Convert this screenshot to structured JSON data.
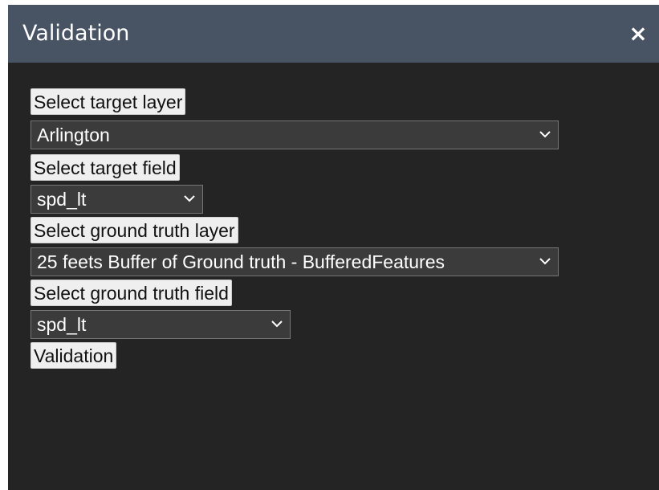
{
  "dialog": {
    "title": "Validation",
    "close_symbol": "×",
    "close_icon": "close-icon"
  },
  "form": {
    "target_layer_button": "Select target layer",
    "target_layer_value": "Arlington",
    "target_field_button": "Select target field",
    "target_field_value": "spd_lt",
    "ground_truth_layer_button": "Select ground truth layer",
    "ground_truth_layer_value": "25 feets Buffer of Ground truth - BufferedFeatures",
    "ground_truth_field_button": "Select ground truth field",
    "ground_truth_field_value": "spd_lt",
    "validation_button": "Validation",
    "chevron_icon": "chevron-down-icon"
  },
  "colors": {
    "header_background": "#485364",
    "panel_background": "#242424",
    "select_background": "#3b3b3b",
    "button_background": "#efefef",
    "text_light": "#ffffff"
  }
}
